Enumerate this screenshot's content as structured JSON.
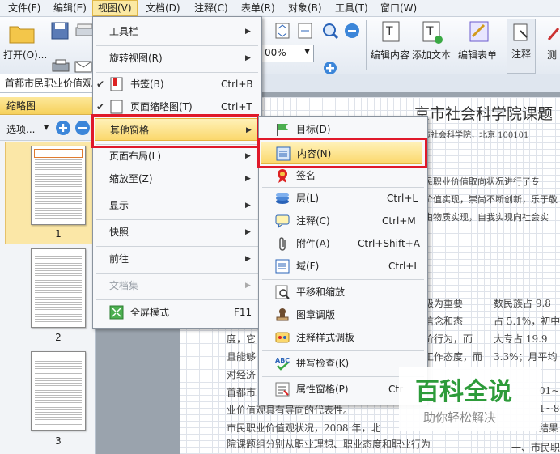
{
  "menubar": {
    "items": [
      "文件(F)",
      "编辑(E)",
      "视图(V)",
      "文档(D)",
      "注释(C)",
      "表单(R)",
      "对象(B)",
      "工具(T)",
      "窗口(W)"
    ]
  },
  "toolbar": {
    "open_label": "打开(O)...",
    "zoom_value": "00%",
    "edit_content": "编辑内容",
    "add_text": "添加文本",
    "edit_form": "编辑表单",
    "annotate": "注释",
    "measure": "测"
  },
  "doc_tab": "首都市民职业价值观",
  "left_panel": {
    "title": "缩略图",
    "options": "选项...",
    "pages": [
      "1",
      "2",
      "3"
    ]
  },
  "view_menu": {
    "items": [
      {
        "label": "工具栏",
        "shortcut": "",
        "submenu": true
      },
      {
        "label": "旋转视图(R)",
        "shortcut": "",
        "submenu": true
      },
      {
        "label": "书签(B)",
        "shortcut": "Ctrl+B",
        "submenu": false,
        "checked": true
      },
      {
        "label": "页面缩略图(T)",
        "shortcut": "Ctrl+T",
        "submenu": false,
        "checked": true
      },
      {
        "label": "其他窗格",
        "shortcut": "",
        "submenu": true
      },
      {
        "label": "页面布局(L)",
        "shortcut": "",
        "submenu": true
      },
      {
        "label": "缩放至(Z)",
        "shortcut": "",
        "submenu": true
      },
      {
        "label": "显示",
        "shortcut": "",
        "submenu": true
      },
      {
        "label": "快照",
        "shortcut": "",
        "submenu": true
      },
      {
        "label": "前往",
        "shortcut": "",
        "submenu": true
      },
      {
        "label": "文档集",
        "shortcut": "",
        "submenu": true,
        "disabled": true
      },
      {
        "label": "全屏模式",
        "shortcut": "F11",
        "submenu": false
      }
    ]
  },
  "panes_menu": {
    "items": [
      {
        "label": "目标(D)",
        "shortcut": "",
        "icon": "flag-icon"
      },
      {
        "label": "内容(N)",
        "shortcut": "",
        "icon": "content-icon"
      },
      {
        "label": "签名",
        "shortcut": "",
        "icon": "ribbon-icon"
      },
      {
        "label": "层(L)",
        "shortcut": "Ctrl+L",
        "icon": "layers-icon"
      },
      {
        "label": "注释(C)",
        "shortcut": "Ctrl+M",
        "icon": "comment-icon"
      },
      {
        "label": "附件(A)",
        "shortcut": "Ctrl+Shift+A",
        "icon": "paperclip-icon"
      },
      {
        "label": "域(F)",
        "shortcut": "Ctrl+I",
        "icon": "field-icon"
      },
      {
        "label": "平移和缩放",
        "shortcut": "",
        "icon": "magnifier-icon"
      },
      {
        "label": "图章调版",
        "shortcut": "",
        "icon": "stamp-icon"
      },
      {
        "label": "注释样式调板",
        "shortcut": "",
        "icon": "palette-icon"
      },
      {
        "label": "拼写检查(K)",
        "shortcut": "",
        "icon": "spellcheck-icon"
      },
      {
        "label": "属性窗格(P)",
        "shortcut": "Ctr",
        "icon": "properties-icon"
      }
    ]
  },
  "document": {
    "title_fragment": "京市社会科学院课题",
    "affil": "京市社会科学院，北京 100101",
    "lines_right": [
      "民职业价值取向状况进行了专",
      "价值实现，崇尚不断创新，乐于敬",
      "由物质实现，自我实现向社会实"
    ],
    "col_left": [
      "级为重要",
      "信念和态",
      "价行为，而",
      "工作态度，而"
    ],
    "col_right": [
      "数民族占 9.8",
      "占 5.1%，初中",
      "大专占 19.9",
      "3.3%；月平均"
    ],
    "bottom_lines": [
      "度，它",
      "且能够",
      "对经济",
      "首都市",
      "业价值观具有导向的代表性。",
      "市民职业价值观状况，2008 年，北",
      "院课题组分别从职业理想、职业态度和职业行为"
    ],
    "bottom_right": [
      "01~",
      "1~80",
      "结果",
      "一、市民职"
    ]
  },
  "watermark": {
    "title": "百科全说",
    "subtitle": "助你轻松解决"
  },
  "colors": {
    "highlight": "#fbd86c",
    "red_box": "#e0192a",
    "watermark_green": "#2d9b3a"
  }
}
